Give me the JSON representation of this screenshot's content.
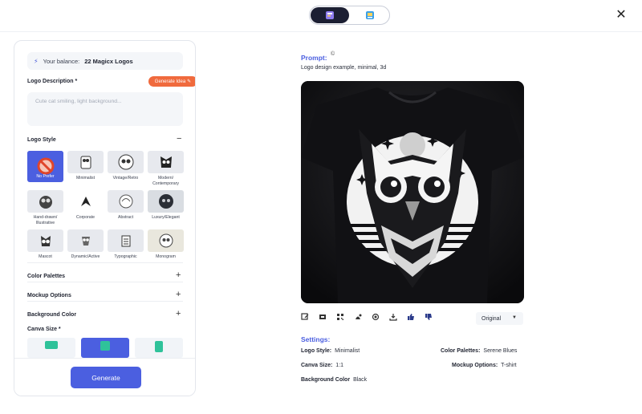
{
  "topbar": {
    "toggle": [
      {
        "name": "ai-generator-mode-icon",
        "active": true
      },
      {
        "name": "mockup-mode-icon",
        "active": false
      }
    ],
    "close_icon": "close-icon"
  },
  "left_panel": {
    "balance_prefix": "Your balance:",
    "balance_value": "22 Magicx Logos",
    "logo_description_label": "Logo Description *",
    "generate_idea_label": "Generate Idea",
    "description_placeholder": "Cute cat smiling, light background...",
    "logo_style_label": "Logo Style",
    "styles": [
      {
        "label": "No Prefer",
        "selected": true
      },
      {
        "label": "Minimalist",
        "selected": false
      },
      {
        "label": "Vintage/Retro",
        "selected": false
      },
      {
        "label": "Modern/ Contemporary",
        "selected": false
      },
      {
        "label": "Hand-drawn/ Illustrative",
        "selected": false
      },
      {
        "label": "Corporate",
        "selected": false
      },
      {
        "label": "Abstract",
        "selected": false
      },
      {
        "label": "Luxury/Elegant",
        "selected": false
      },
      {
        "label": "Mascot",
        "selected": false
      },
      {
        "label": "Dynamic/Active",
        "selected": false
      },
      {
        "label": "Typographic",
        "selected": false
      },
      {
        "label": "Monogram",
        "selected": false
      }
    ],
    "color_palettes_label": "Color Palettes",
    "mockup_options_label": "Mockup Options",
    "background_color_label": "Background Color",
    "canva_size_label": "Canva Size *",
    "canva_selected_index": 1,
    "generate_label": "Generate"
  },
  "right_panel": {
    "prompt_label": "Prompt:",
    "prompt_text": "Logo design example, minimal, 3d",
    "preview_image": "owl-logo-tshirt-mockup",
    "actions": [
      "edit-icon",
      "mockup-icon",
      "qr-icon",
      "recolor-icon",
      "copy-icon",
      "download-icon",
      "thumbs-up-icon",
      "thumbs-down-icon"
    ],
    "size_select": "Original",
    "settings_label": "Settings:",
    "settings": {
      "logo_style_key": "Logo Style:",
      "logo_style_val": "Minimalist",
      "color_palettes_key": "Color Palettes:",
      "color_palettes_val": "Serene Blues",
      "canva_size_key": "Canva Size:",
      "canva_size_val": "1:1",
      "mockup_options_key": "Mockup Options:",
      "mockup_options_val": "T-shirt",
      "background_color_key": "Background Color",
      "background_color_val": "Black"
    }
  },
  "colors": {
    "accent": "#4b5fe0",
    "orange": "#f06a3d",
    "dark": "#1c1f33"
  }
}
